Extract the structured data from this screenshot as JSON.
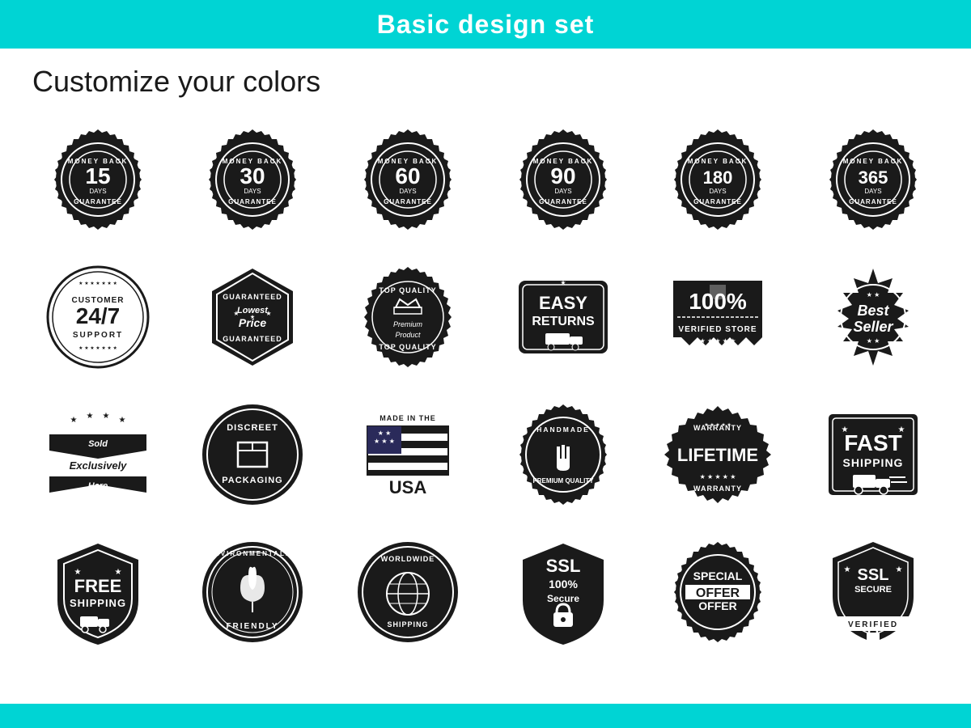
{
  "header": {
    "title": "Basic design set",
    "subtitle": "Customize your colors"
  },
  "badges": [
    {
      "id": "money-back-15",
      "label": "Money Back 15 Days Guarantee"
    },
    {
      "id": "money-back-30",
      "label": "Money Back 30 Days Guarantee"
    },
    {
      "id": "money-back-60",
      "label": "Money Back 60 Days Guarantee"
    },
    {
      "id": "money-back-90",
      "label": "Money Back 90 Days Guarantee"
    },
    {
      "id": "money-back-180",
      "label": "Money Back 180 Days Guarantee"
    },
    {
      "id": "money-back-365",
      "label": "Money Back 365 Days Guarantee"
    },
    {
      "id": "customer-247",
      "label": "Customer 24/7 Support"
    },
    {
      "id": "lowest-price",
      "label": "Guaranteed Lowest Price Guaranteed"
    },
    {
      "id": "top-quality",
      "label": "Top Quality Premium Product"
    },
    {
      "id": "easy-returns",
      "label": "Easy Returns"
    },
    {
      "id": "100-verified",
      "label": "100% Verified Store"
    },
    {
      "id": "best-seller",
      "label": "Best Seller"
    },
    {
      "id": "sold-exclusively",
      "label": "Sold Exclusively Here"
    },
    {
      "id": "discreet-packaging",
      "label": "Discreet Packaging"
    },
    {
      "id": "made-in-usa",
      "label": "Made in the USA"
    },
    {
      "id": "handmade",
      "label": "Handmade Premium Quality"
    },
    {
      "id": "lifetime-warranty",
      "label": "Lifetime Warranty"
    },
    {
      "id": "fast-shipping",
      "label": "Fast Shipping"
    },
    {
      "id": "free-shipping",
      "label": "Free Shipping"
    },
    {
      "id": "eco-friendly",
      "label": "Environmentally Friendly"
    },
    {
      "id": "worldwide-shipping",
      "label": "Worldwide Shipping"
    },
    {
      "id": "ssl-secure",
      "label": "SSL 100% Secure"
    },
    {
      "id": "special-offer",
      "label": "Special Offer"
    },
    {
      "id": "ssl-verified",
      "label": "SSL Secure Verified"
    }
  ]
}
